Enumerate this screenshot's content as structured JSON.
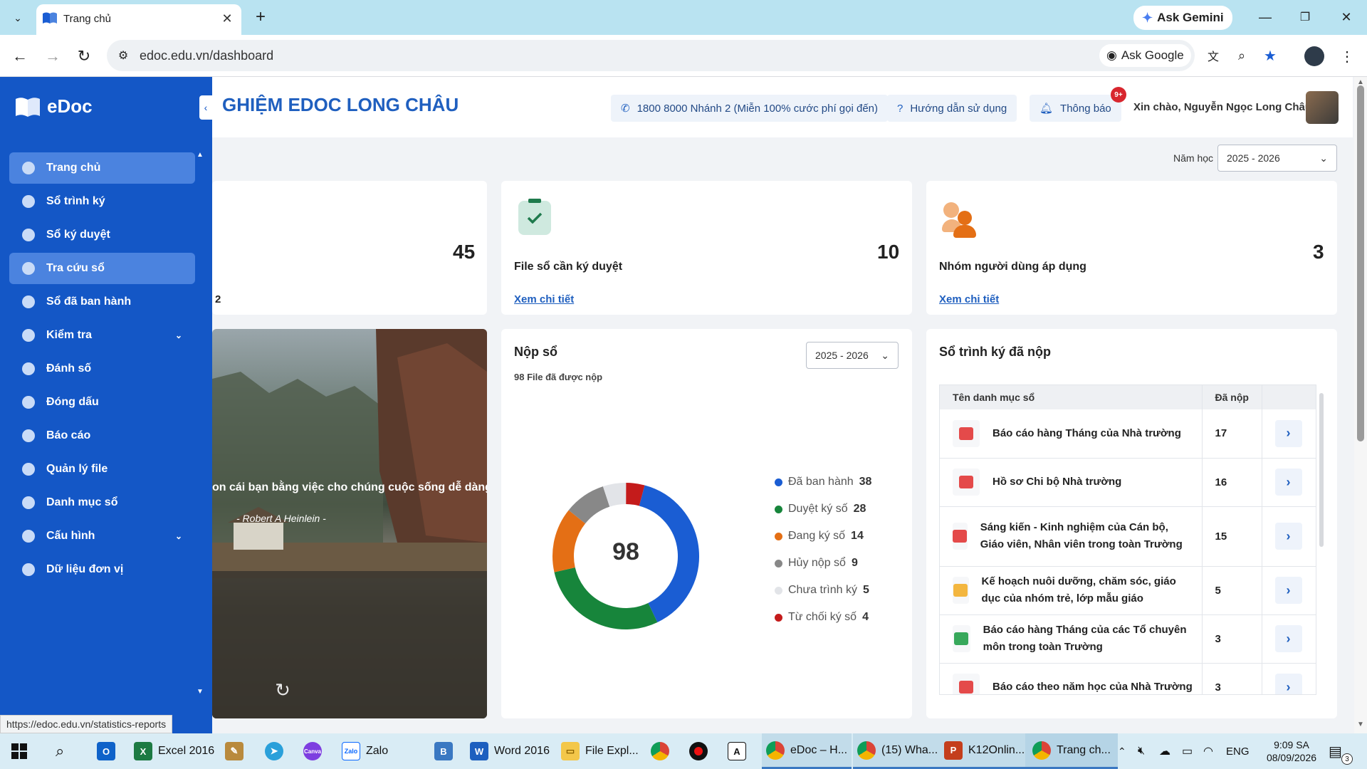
{
  "browser": {
    "tab_title": "Trang chủ",
    "url": "edoc.edu.vn/dashboard",
    "ask_gemini": "Ask Gemini",
    "ask_google": "Ask Google",
    "status_url": "https://edoc.edu.vn/statistics-reports"
  },
  "brand": {
    "name": "eDoc"
  },
  "sidebar": {
    "items": [
      {
        "label": "Trang chủ"
      },
      {
        "label": "Sổ trình ký"
      },
      {
        "label": "Sổ ký duyệt"
      },
      {
        "label": "Tra cứu sổ"
      },
      {
        "label": "Sổ đã ban hành"
      },
      {
        "label": "Kiểm tra"
      },
      {
        "label": "Đánh số"
      },
      {
        "label": "Đóng dấu"
      },
      {
        "label": "Báo cáo"
      },
      {
        "label": "Quản lý file"
      },
      {
        "label": "Danh mục sổ"
      },
      {
        "label": "Cấu hình"
      },
      {
        "label": "Dữ liệu đơn vị"
      }
    ]
  },
  "header": {
    "title": "GHIỆM EDOC LONG CHÂU",
    "hotline": "1800 8000 Nhánh 2 (Miễn 100% cước phí gọi đến)",
    "guide": "Hướng dẫn sử dụng",
    "notify": "Thông báo",
    "notify_badge": "9+",
    "greeting": "Xin chào, Nguyễn Ngọc Long Châu"
  },
  "filter": {
    "label": "Năm học",
    "value": "2025 - 2026"
  },
  "stats": {
    "card1": {
      "value": "45",
      "sub": "2"
    },
    "card2": {
      "value": "10",
      "label": "File sổ cần ký duyệt",
      "link": "Xem chi tiết"
    },
    "card3": {
      "value": "3",
      "label": "Nhóm người dùng áp dụng",
      "link": "Xem chi tiết"
    }
  },
  "quote": {
    "text": "on cái bạn bằng việc cho chúng cuộc sống dễ dàng.\"",
    "author": "- Robert A Heinlein -"
  },
  "nop_so": {
    "title": "Nộp sổ",
    "sub": "98 File đã được nộp",
    "year": "2025 - 2026",
    "total": "98"
  },
  "chart_data": {
    "type": "pie",
    "categories": [
      "Đã ban hành",
      "Duyệt ký số",
      "Đang ký số",
      "Hủy nộp sổ",
      "Chưa trình ký",
      "Từ chối ký số"
    ],
    "values": [
      38,
      28,
      14,
      9,
      5,
      4
    ],
    "colors": [
      "#1a5dd3",
      "#17853b",
      "#e46f15",
      "#888888",
      "#e2e4e8",
      "#c41b1b"
    ]
  },
  "submitted": {
    "title": "Sổ trình ký đã nộp",
    "col_name": "Tên danh mục sổ",
    "col_count": "Đã nộp",
    "rows": [
      {
        "name": "Báo cáo hàng Tháng của Nhà trường",
        "count": "17",
        "icon": "pdf-icon",
        "color": "#e44a4a"
      },
      {
        "name": "Hồ sơ Chi bộ Nhà trường",
        "count": "16",
        "icon": "pdf-icon",
        "color": "#e44a4a"
      },
      {
        "name": "Sáng kiến - Kinh nghiệm của Cán bộ, Giáo viên, Nhân viên trong toàn Trường",
        "count": "15",
        "icon": "pdf-icon",
        "color": "#e44a4a"
      },
      {
        "name": "Kế hoạch nuôi dưỡng, chăm sóc, giáo dục của nhóm trẻ, lớp mẫu giáo",
        "count": "5",
        "icon": "ppt-icon",
        "color": "#f3b63f"
      },
      {
        "name": "Báo cáo hàng Tháng của các Tổ chuyên môn trong toàn Trường",
        "count": "3",
        "icon": "excel-icon",
        "color": "#37a85b"
      },
      {
        "name": "Báo cáo theo năm học của Nhà Trường",
        "count": "3",
        "icon": "pdf-icon",
        "color": "#e44a4a"
      }
    ]
  },
  "taskbar": {
    "excel": "Excel 2016",
    "zalo": "Zalo",
    "word": "Word 2016",
    "explorer": "File Expl...",
    "edoc": "eDoc – H...",
    "whatsapp": "(15) Wha...",
    "k12": "K12Onlin...",
    "trangchu": "Trang ch...",
    "lang": "ENG",
    "time": "9:09 SA",
    "date": "08/09/2026",
    "notif_count": "3"
  }
}
